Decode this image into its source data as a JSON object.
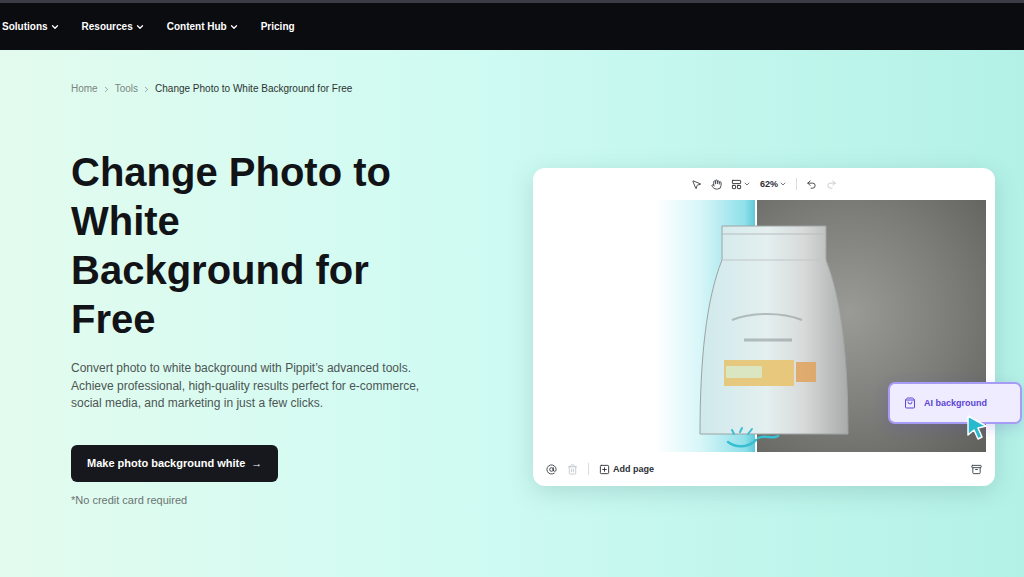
{
  "nav": [
    {
      "label": "Solutions",
      "dropdown": true
    },
    {
      "label": "Resources",
      "dropdown": true
    },
    {
      "label": "Content Hub",
      "dropdown": true
    },
    {
      "label": "Pricing",
      "dropdown": false
    }
  ],
  "breadcrumb": [
    "Home",
    "Tools",
    "Change Photo to White Background for Free"
  ],
  "hero": {
    "title": "Change Photo to White Background for Free",
    "description": "Convert photo to white background with Pippit’s advanced tools. Achieve professional, high-quality results perfect for e-commerce, social media, and marketing in just a few clicks.",
    "button": "Make photo background white",
    "button_icon": "→",
    "note": "*No credit card required"
  },
  "editor": {
    "zoom": "62%",
    "add_page": "Add page",
    "badge": "AI background"
  }
}
